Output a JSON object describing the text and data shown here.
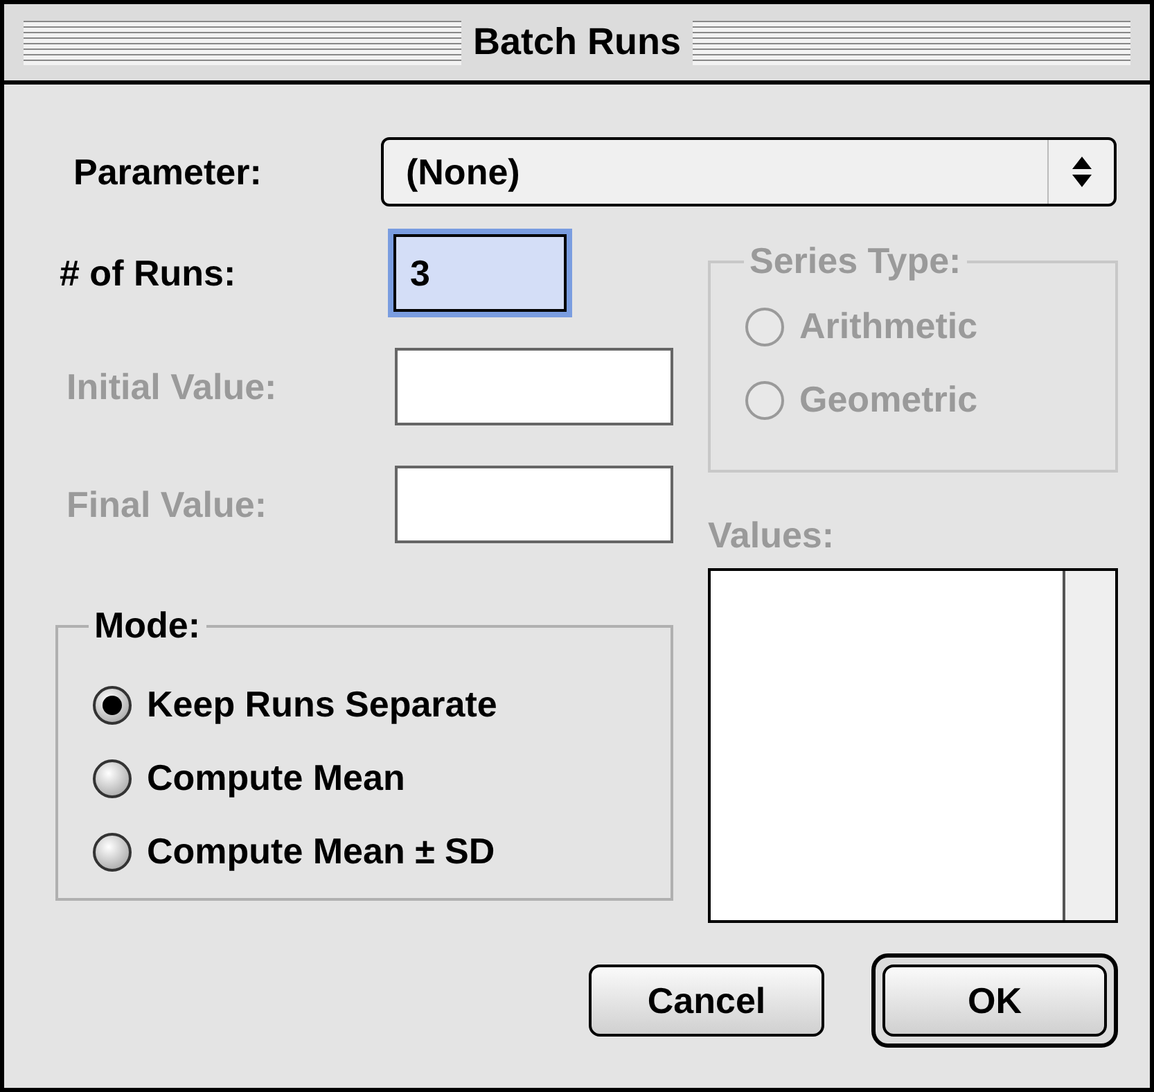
{
  "window": {
    "title": "Batch Runs"
  },
  "parameter": {
    "label": "Parameter:",
    "value": "(None)"
  },
  "fields": [
    {
      "label": "# of Runs:",
      "value": "3",
      "disabled": false,
      "focused": true
    },
    {
      "label": "Initial Value:",
      "disabled": true,
      "focused": false
    },
    {
      "label": "Final Value:",
      "disabled": true,
      "focused": false
    }
  ],
  "series_type": {
    "label": "Series Type:",
    "disabled": true,
    "options": [
      {
        "label": "Arithmetic",
        "selected": false
      },
      {
        "label": "Geometric",
        "selected": false
      }
    ]
  },
  "mode": {
    "label": "Mode:",
    "disabled": false,
    "options": [
      {
        "label": "Keep Runs Separate",
        "selected": true
      },
      {
        "label": "Compute Mean",
        "selected": false
      },
      {
        "label": "Compute Mean ± SD",
        "selected": false
      }
    ]
  },
  "values": {
    "label": "Values:",
    "disabled": true
  },
  "buttons": [
    {
      "label": "Cancel",
      "default": false
    },
    {
      "label": "OK",
      "default": true
    }
  ]
}
